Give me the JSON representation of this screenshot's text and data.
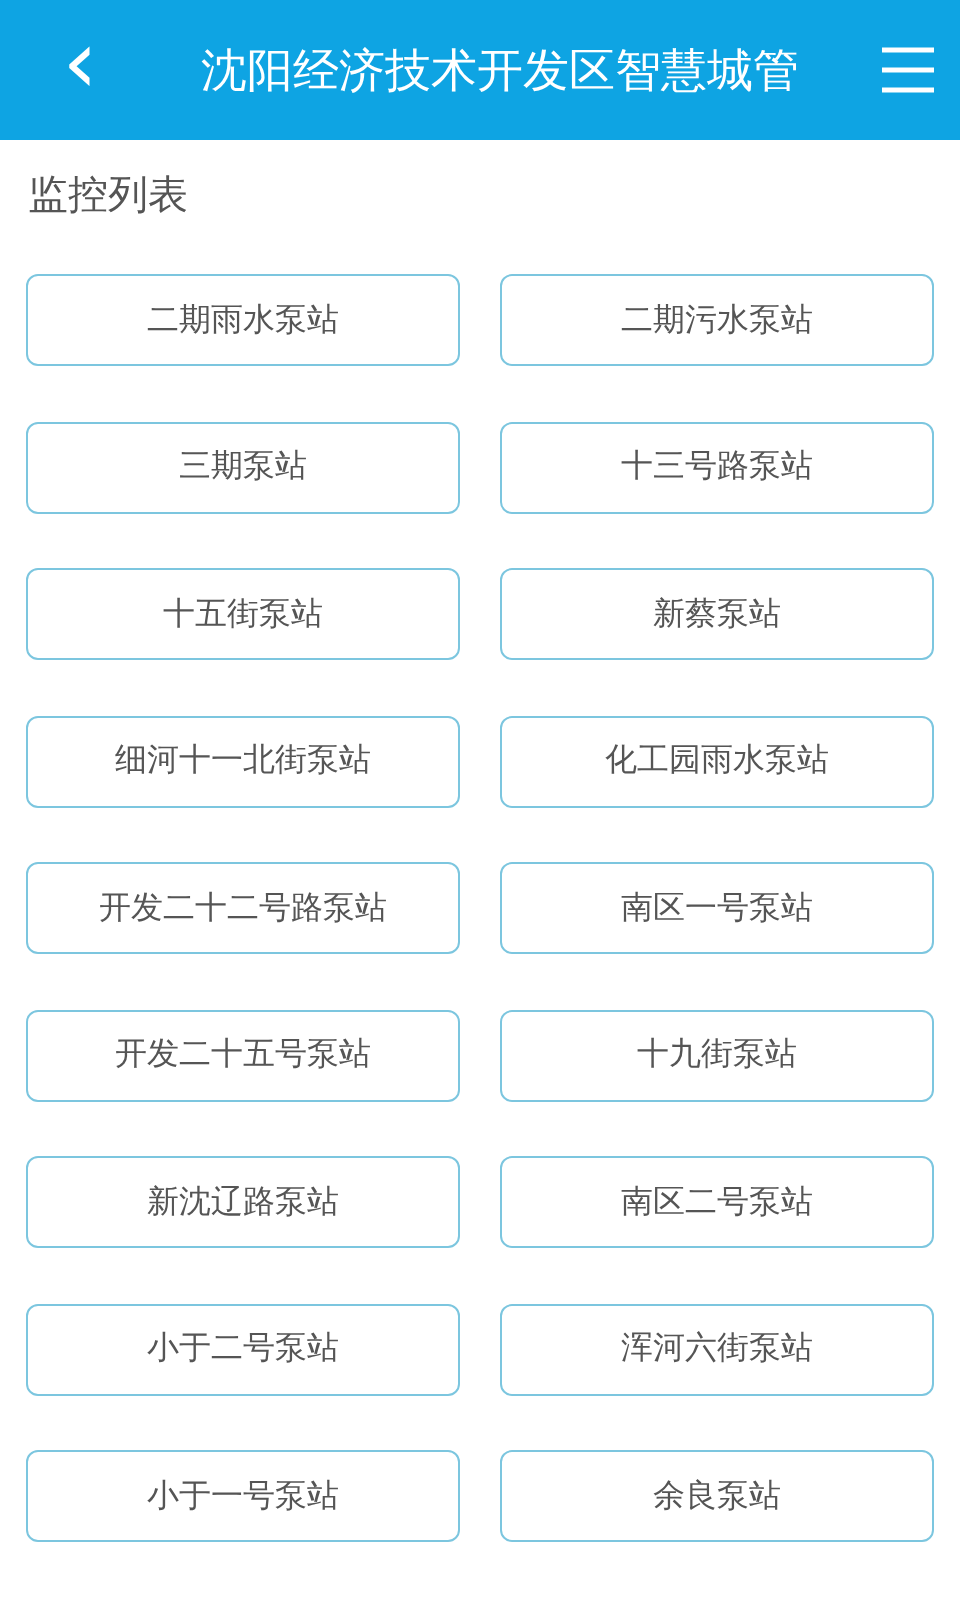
{
  "header": {
    "back_icon": "‹",
    "title": "沈阳经济技术开发区智慧城管"
  },
  "section_title": "监控列表",
  "stations": [
    {
      "name": "二期雨水泵站"
    },
    {
      "name": "二期污水泵站"
    },
    {
      "name": "三期泵站"
    },
    {
      "name": "十三号路泵站"
    },
    {
      "name": "十五街泵站"
    },
    {
      "name": "新蔡泵站"
    },
    {
      "name": "细河十一北街泵站"
    },
    {
      "name": "化工园雨水泵站"
    },
    {
      "name": "开发二十二号路泵站"
    },
    {
      "name": "南区一号泵站"
    },
    {
      "name": "开发二十五号泵站"
    },
    {
      "name": "十九街泵站"
    },
    {
      "name": "新沈辽路泵站"
    },
    {
      "name": "南区二号泵站"
    },
    {
      "name": "小于二号泵站"
    },
    {
      "name": "浑河六街泵站"
    },
    {
      "name": "小于一号泵站"
    },
    {
      "name": "余良泵站"
    }
  ]
}
